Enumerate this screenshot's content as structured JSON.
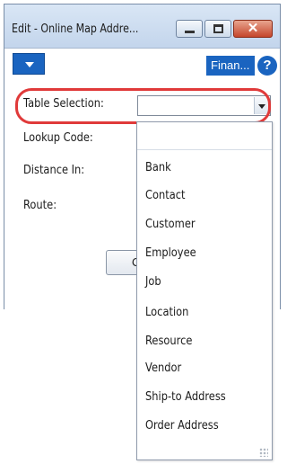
{
  "window": {
    "title": "Edit - Online Map Addre...",
    "close_symbol": "✕"
  },
  "actionbar": {
    "finance_label": "Finan...",
    "help_symbol": "?"
  },
  "fields": {
    "table_selection_label": "Table Selection:",
    "lookup_code_label": "Lookup Code:",
    "distance_in_label": "Distance In:",
    "route_label": "Route:",
    "table_selection_value": ""
  },
  "ok_button_label": "OK",
  "dropdown": {
    "options": [
      "",
      "Bank",
      "Contact",
      "Customer",
      "Employee",
      "Job",
      "Location",
      "Resource",
      "Vendor",
      "Ship-to Address",
      "Order Address"
    ]
  },
  "colors": {
    "accent_blue": "#1a64c0",
    "highlight_red": "#e03a3a",
    "close_red": "#c5462c"
  }
}
